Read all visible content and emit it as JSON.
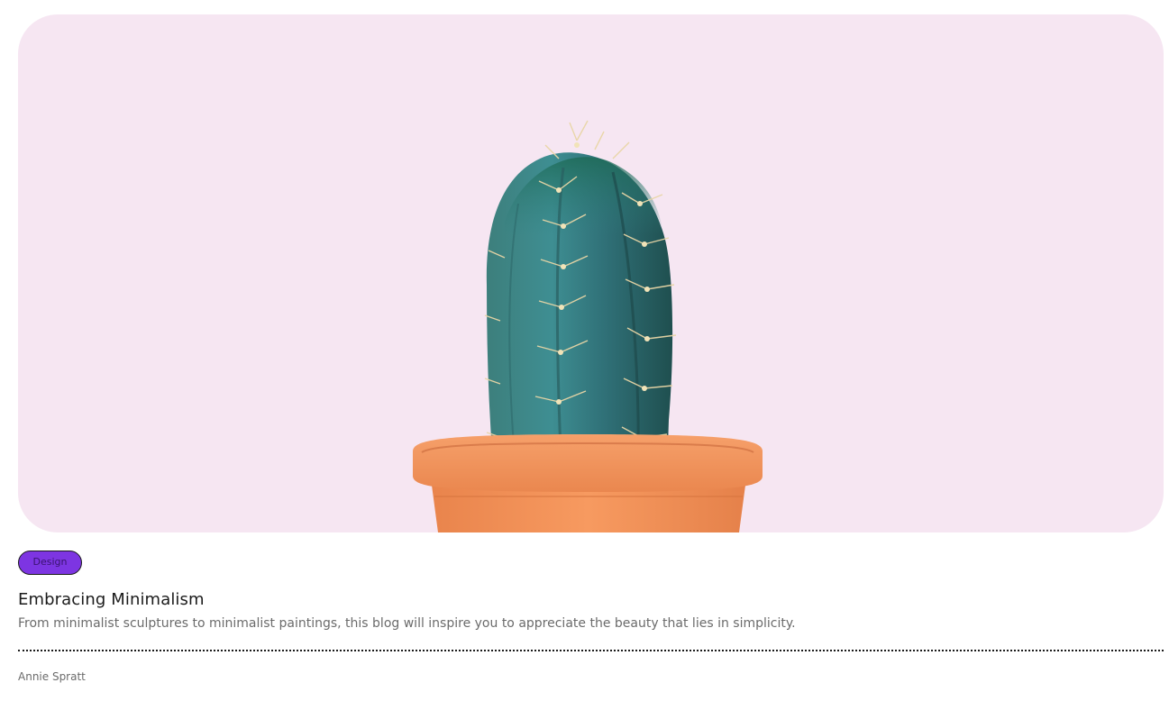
{
  "post": {
    "category": "Design",
    "title": "Embracing Minimalism",
    "excerpt": "From minimalist sculptures to minimalist paintings, this blog will inspire you to appreciate the beauty that lies in simplicity.",
    "author": "Annie Spratt"
  },
  "hero_image": {
    "subject": "cactus-in-terracotta-pot",
    "background_color": "#f6e6f2"
  },
  "colors": {
    "tag_background": "#7d35e2",
    "title_text": "#1b1b1b",
    "muted_text": "#6b6b6b"
  }
}
